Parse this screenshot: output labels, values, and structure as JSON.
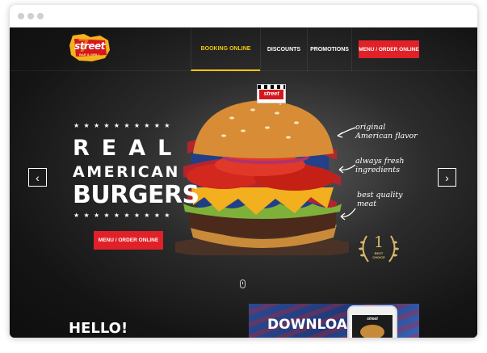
{
  "header": {
    "logo_text": "street",
    "logo_sub": "BAR & GRILL",
    "nav": [
      {
        "label": "BOOKING ONLINE",
        "active": true
      },
      {
        "label": "DISCOUNTS",
        "active": false
      },
      {
        "label": "PROMOTIONS",
        "active": false
      }
    ],
    "order_button": "MENU / ORDER ONLINE"
  },
  "hero": {
    "stars_top": "★★★★★★★★★★",
    "stars_bottom": "★★★★★★★★★★",
    "line1": "REAL",
    "line2": "AMERICAN",
    "line3": "BURGERS",
    "button": "MENU / ORDER ONLINE",
    "flag_text": "street",
    "notes": [
      "original American flavor",
      "always fresh ingredients",
      "best quality meat"
    ],
    "badge_number": "1",
    "badge_text": "BEST CHOICE",
    "prev_arrow": "‹",
    "next_arrow": "›"
  },
  "below": {
    "hello": "HELLO!",
    "promo_title": "DOWNLOAD",
    "phone_brand": "street"
  },
  "colors": {
    "accent_red": "#e02128",
    "active_yellow": "#f4c70f",
    "gold": "#d9b56a",
    "background": "#1a1a1a"
  },
  "icons": [
    "prev-arrow-icon",
    "next-arrow-icon",
    "scroll-mouse-icon",
    "laurel-badge-icon",
    "checkered-flag-icon"
  ]
}
